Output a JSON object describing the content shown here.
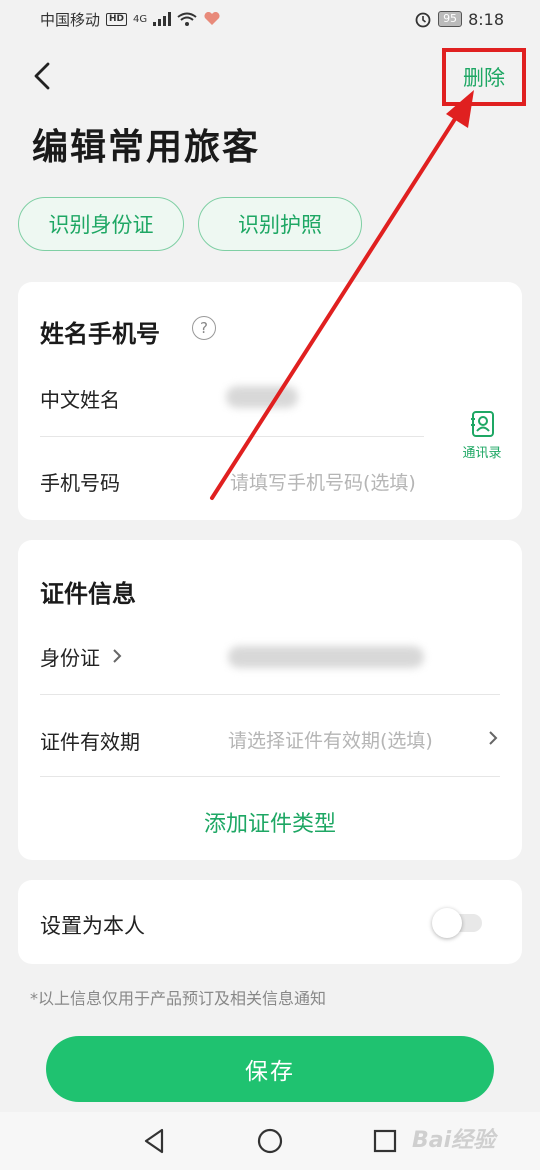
{
  "status_bar": {
    "carrier": "中国移动",
    "hd": "HD",
    "network": "4G",
    "battery": "95",
    "time": "8:18"
  },
  "header": {
    "title": "编辑常用旅客",
    "delete_label": "删除"
  },
  "quick_actions": {
    "scan_id": "识别身份证",
    "scan_passport": "识别护照"
  },
  "name_phone": {
    "title": "姓名手机号",
    "help": "?",
    "chinese_name_label": "中文姓名",
    "phone_label": "手机号码",
    "phone_placeholder": "请填写手机号码(选填)",
    "contacts_label": "通讯录"
  },
  "certificate": {
    "title": "证件信息",
    "id_type_label": "身份证",
    "validity_label": "证件有效期",
    "validity_placeholder": "请选择证件有效期(选填)",
    "add_type_label": "添加证件类型"
  },
  "self": {
    "label": "设置为本人",
    "enabled": false
  },
  "notice": "*以上信息仅用于产品预订及相关信息通知",
  "save_label": "保存",
  "watermark": "Bai经验",
  "colors": {
    "accent": "#1ea764",
    "primary_button": "#1fc270",
    "annotation": "#e02020"
  }
}
